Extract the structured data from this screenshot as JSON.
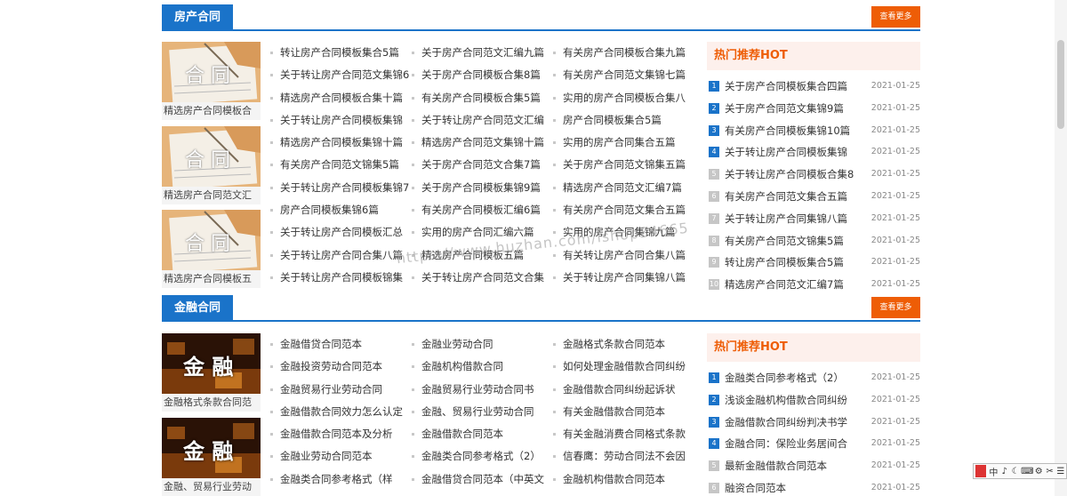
{
  "watermark": "https://www.huzhan.com/ishop34665",
  "more_label": "查看更多",
  "sections": [
    {
      "title": "房产合同",
      "thumbs": [
        {
          "img_text": "合 同",
          "caption": "精选房产合同模板合"
        },
        {
          "img_text": "合 同",
          "caption": "精选房产合同范文汇"
        },
        {
          "img_text": "合 同",
          "caption": "精选房产合同模板五"
        }
      ],
      "columns": [
        [
          "转让房产合同模板集合5篇",
          "关于转让房产合同范文集锦6",
          "精选房产合同模板合集十篇",
          "关于转让房产合同模板集锦",
          "精选房产合同模板集锦十篇",
          "有关房产合同范文锦集5篇",
          "关于转让房产合同模板集锦7",
          "房产合同模板集锦6篇",
          "关于转让房产合同模板汇总",
          "关于转让房产合同合集八篇",
          "关于转让房产合同模板锦集"
        ],
        [
          "关于房产合同范文汇编九篇",
          "关于房产合同模板合集8篇",
          "有关房产合同模板合集5篇",
          "关于转让房产合同范文汇编",
          "精选房产合同范文集锦十篇",
          "关于房产合同范文合集7篇",
          "关于房产合同模板集锦9篇",
          "有关房产合同模板汇编6篇",
          "实用的房产合同汇编六篇",
          "精选房产合同模板五篇",
          "关于转让房产合同范文合集"
        ],
        [
          "有关房产合同模板合集九篇",
          "有关房产合同范文集锦七篇",
          "实用的房产合同模板合集八",
          "房产合同模板集合5篇",
          "实用的房产合同集合五篇",
          "关于房产合同范文锦集五篇",
          "精选房产合同范文汇编7篇",
          "有关房产合同范文集合五篇",
          "实用的房产合同集锦九篇",
          "有关转让房产合同合集八篇",
          "关于转让房产合同集锦八篇"
        ]
      ],
      "hot_title": "热门推荐HOT",
      "hot": [
        {
          "num": "1",
          "text": "关于房产合同模板集合四篇",
          "date": "2021-01-25"
        },
        {
          "num": "2",
          "text": "关于房产合同范文集锦9篇",
          "date": "2021-01-25"
        },
        {
          "num": "3",
          "text": "有关房产合同模板集锦10篇",
          "date": "2021-01-25"
        },
        {
          "num": "4",
          "text": "关于转让房产合同模板集锦",
          "date": "2021-01-25"
        },
        {
          "num": "5",
          "text": "关于转让房产合同模板合集8",
          "date": "2021-01-25"
        },
        {
          "num": "6",
          "text": "有关房产合同范文集合五篇",
          "date": "2021-01-25"
        },
        {
          "num": "7",
          "text": "关于转让房产合同集锦八篇",
          "date": "2021-01-25"
        },
        {
          "num": "8",
          "text": "有关房产合同范文锦集5篇",
          "date": "2021-01-25"
        },
        {
          "num": "9",
          "text": "转让房产合同模板集合5篇",
          "date": "2021-01-25"
        },
        {
          "num": "10",
          "text": "精选房产合同范文汇编7篇",
          "date": "2021-01-25"
        }
      ]
    },
    {
      "title": "金融合同",
      "thumbs": [
        {
          "img_text": "金 融",
          "caption": "金融格式条款合同范"
        },
        {
          "img_text": "金 融",
          "caption": "金融、贸易行业劳动"
        }
      ],
      "columns": [
        [
          "金融借贷合同范本",
          "金融投资劳动合同范本",
          "金融贸易行业劳动合同",
          "金融借款合同效力怎么认定",
          "金融借款合同范本及分析",
          "金融业劳动合同范本",
          "金融类合同参考格式（样"
        ],
        [
          "金融业劳动合同",
          "金融机构借款合同",
          "金融贸易行业劳动合同书",
          "金融、贸易行业劳动合同",
          "金融借款合同范本",
          "金融类合同参考格式（2）",
          "金融借贷合同范本（中英文"
        ],
        [
          "金融格式条款合同范本",
          "如何处理金融借款合同纠纷",
          "金融借款合同纠纷起诉状",
          "有关金融借款合同范本",
          "有关金融消费合同格式条款",
          "信春鹰：劳动合同法不会因",
          "金融机构借款合同范本"
        ]
      ],
      "hot_title": "热门推荐HOT",
      "hot": [
        {
          "num": "1",
          "text": "金融类合同参考格式（2）",
          "date": "2021-01-25"
        },
        {
          "num": "2",
          "text": "浅谈金融机构借款合同纠纷",
          "date": "2021-01-25"
        },
        {
          "num": "3",
          "text": "金融借款合同纠纷判决书学",
          "date": "2021-01-25"
        },
        {
          "num": "4",
          "text": "金融合同：保险业务居间合",
          "date": "2021-01-25"
        },
        {
          "num": "5",
          "text": "最新金融借款合同范本",
          "date": "2021-01-25"
        },
        {
          "num": "6",
          "text": "融资合同范本",
          "date": "2021-01-25"
        }
      ]
    }
  ],
  "ime": [
    "中",
    "♪",
    "☾",
    "⌨",
    "⚙",
    "✂",
    "☰"
  ]
}
